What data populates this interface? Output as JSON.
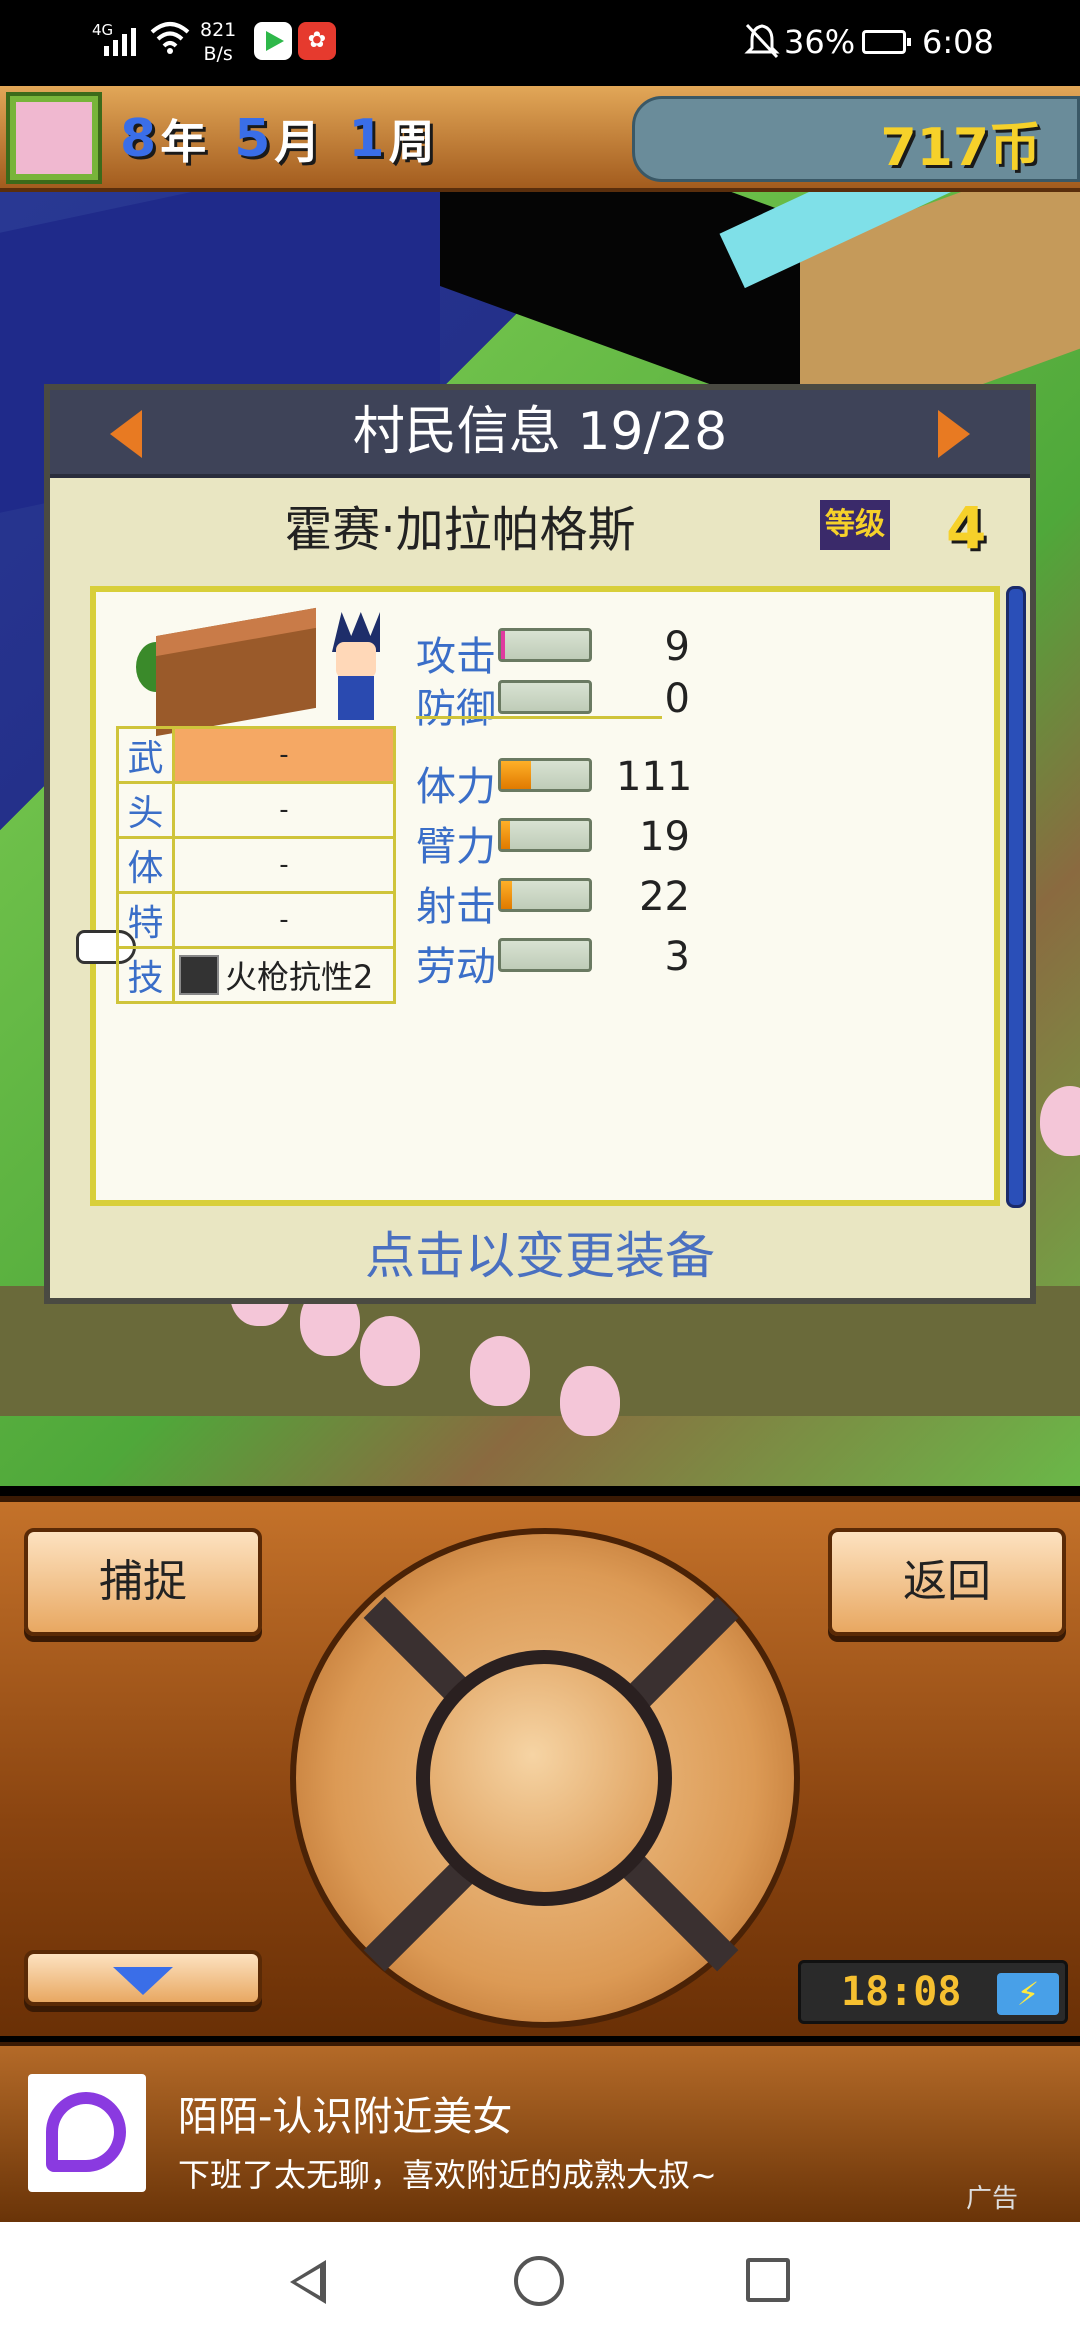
{
  "status_bar": {
    "network": "4G",
    "net_speed": "821",
    "net_speed_unit": "B/s",
    "battery": "36%",
    "time": "6:08",
    "icons": [
      "signal-icon",
      "wifi-icon",
      "app-icon",
      "app-icon",
      "mute-icon",
      "battery-icon"
    ]
  },
  "top_bar": {
    "year_num": "8",
    "year_unit": "年",
    "month_num": "5",
    "month_unit": "月",
    "week_num": "1",
    "week_unit": "周",
    "coins": "717币"
  },
  "villager_panel": {
    "title": "村民信息 19/28",
    "name": "霍赛·加拉帕格斯",
    "rank_label": "等级",
    "rank_value": "4",
    "equipment": [
      {
        "slot": "武",
        "value": "-",
        "selected": true
      },
      {
        "slot": "头",
        "value": "-"
      },
      {
        "slot": "体",
        "value": "-"
      },
      {
        "slot": "特",
        "value": "-"
      },
      {
        "slot": "技",
        "value": "火枪抗性2"
      }
    ],
    "stats": [
      {
        "label": "攻击",
        "value": "9"
      },
      {
        "label": "防御",
        "value": "0"
      },
      {
        "label": "体力",
        "value": "111"
      },
      {
        "label": "臂力",
        "value": "19"
      },
      {
        "label": "射击",
        "value": "22"
      },
      {
        "label": "劳动",
        "value": "3"
      }
    ],
    "change_equipment_label": "点击以变更装备"
  },
  "controller": {
    "capture_label": "捕捉",
    "back_label": "返回",
    "clock": "18:08"
  },
  "ad": {
    "title": "陌陌-认识附近美女",
    "description": "下班了太无聊，喜欢附近的成熟大叔~",
    "label": "广告"
  }
}
